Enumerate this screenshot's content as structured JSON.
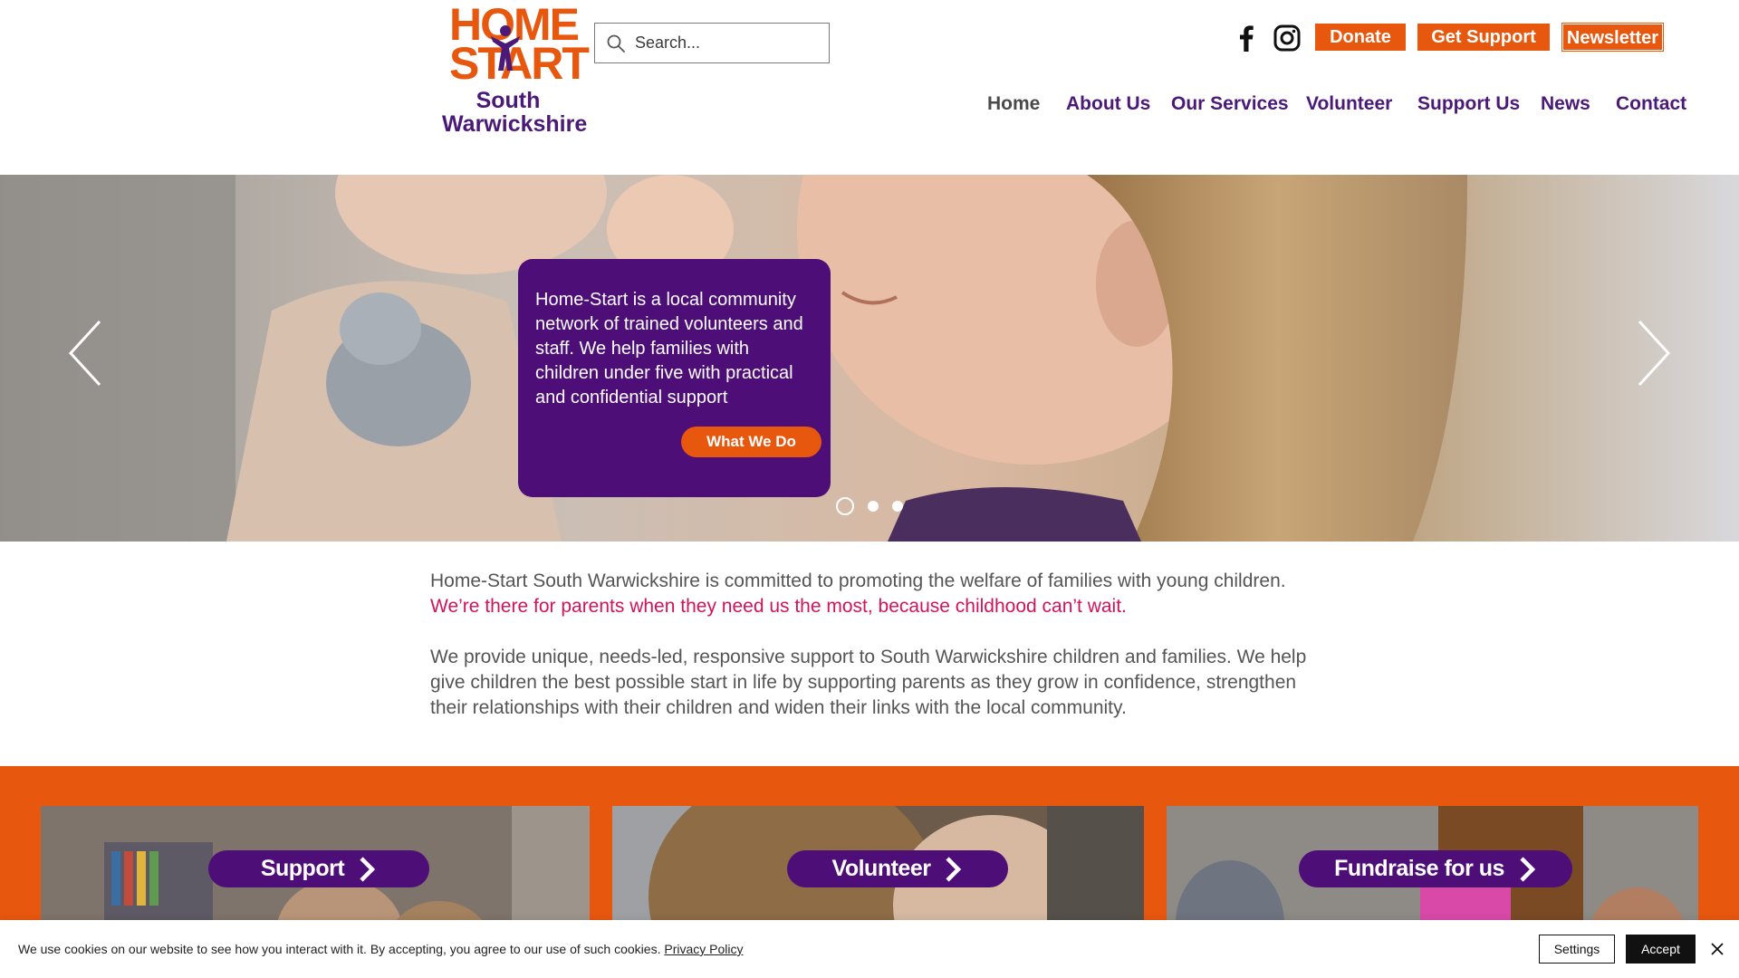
{
  "header": {
    "logo": {
      "wordmark_top": "HOME",
      "wordmark_bottom": "START",
      "sub_line1": "South",
      "sub_line2": "Warwickshire",
      "colors": {
        "orange": "#e8570e",
        "purple": "#4b1a78"
      }
    },
    "search": {
      "placeholder": "Search...",
      "value": "",
      "icon": "search-icon"
    },
    "social": [
      {
        "name": "facebook",
        "icon": "facebook-icon"
      },
      {
        "name": "instagram",
        "icon": "instagram-icon"
      }
    ],
    "buttons": {
      "donate": "Donate",
      "get_support": "Get Support",
      "newsletter": "Newsletter"
    },
    "nav": [
      {
        "label": "Home",
        "active": true
      },
      {
        "label": "About Us"
      },
      {
        "label": "Our Services"
      },
      {
        "label": "Volunteer"
      },
      {
        "label": "Support Us"
      },
      {
        "label": "News"
      },
      {
        "label": "Contact"
      }
    ]
  },
  "hero": {
    "card_text": "Home-Start is a local community network of trained volunteers and staff. We help families with children under five with practical and confidential support",
    "card_button": "What We Do",
    "slide_count": 3,
    "active_slide": 1,
    "prev_icon": "chevron-left-icon",
    "next_icon": "chevron-right-icon"
  },
  "intro": {
    "line1": "Home-Start South Warwickshire is committed to promoting the welfare of families with young children.",
    "line2": "We’re there for parents when they need us the most, because childhood can’t wait.",
    "paragraph": "We provide unique, needs-led, responsive support to South Warwickshire children and families. We help give children the best possible start in life by supporting parents as they grow in confidence, strengthen their relationships with their children and widen their links with the local community."
  },
  "tiles": [
    {
      "label": "Support"
    },
    {
      "label": "Volunteer"
    },
    {
      "label": "Fundraise for us"
    }
  ],
  "cookie": {
    "text": "We use cookies on our website to see how you interact with it. By accepting, you agree to our use of such cookies.",
    "policy_link": "Privacy Policy",
    "settings": "Settings",
    "accept": "Accept"
  },
  "colors": {
    "brand_orange": "#e8570e",
    "brand_purple": "#4e0e78",
    "highlight_pink": "#d1145a"
  }
}
